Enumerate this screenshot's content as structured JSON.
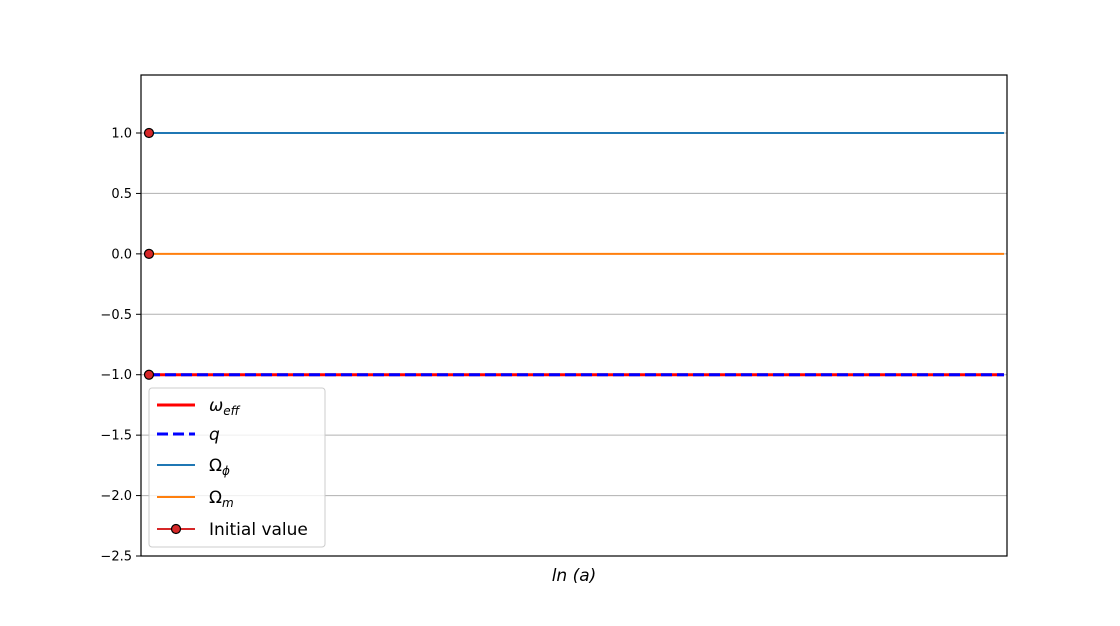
{
  "chart_data": {
    "type": "line",
    "xlabel": "ln (a)",
    "ylabel": "",
    "title": "",
    "ylim": [
      -2.5,
      1.48
    ],
    "yticks": [
      1.0,
      0.5,
      0.0,
      -0.5,
      -1.0,
      -1.5,
      -2.0,
      -2.5
    ],
    "ytick_labels": [
      "1.0",
      "0.5",
      "0.0",
      "−0.5",
      "−1.0",
      "−1.5",
      "−2.0",
      "−2.5"
    ],
    "xticks_shown": false,
    "grid": "horizontal",
    "legend_position": "lower-left",
    "series": [
      {
        "name": "ω_eff",
        "label_main": "ω",
        "label_sub": "eff",
        "label_sub_italic": true,
        "value": -1.0,
        "color": "#ff0000",
        "style": "solid"
      },
      {
        "name": "q",
        "label_main": "q",
        "label_sub": "",
        "label_sub_italic": true,
        "value": -1.0,
        "color": "#0000ff",
        "style": "dashed"
      },
      {
        "name": "Ω_ϕ",
        "label_main": "Ω",
        "label_sub": "ϕ",
        "label_sub_italic": true,
        "value": 1.0,
        "color": "#1f77b4",
        "style": "solid"
      },
      {
        "name": "Ω_m",
        "label_main": "Ω",
        "label_sub": "m",
        "label_sub_italic": true,
        "value": 0.0,
        "color": "#ff7f0e",
        "style": "solid"
      }
    ],
    "initial_values": {
      "name": "Initial value",
      "color": "#d62728",
      "points": [
        1.0,
        0.0,
        -1.0
      ]
    }
  }
}
